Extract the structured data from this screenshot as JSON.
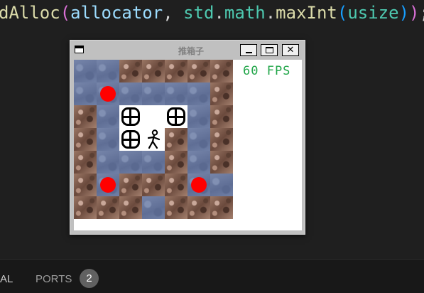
{
  "editor": {
    "tokens": [
      {
        "text": "dAlloc",
        "cls": "tok-fn"
      },
      {
        "text": "(",
        "cls": "tok-p1"
      },
      {
        "text": "allocator",
        "cls": "tok-var"
      },
      {
        "text": ", ",
        "cls": "tok-plain"
      },
      {
        "text": "std",
        "cls": "tok-ns"
      },
      {
        "text": ".",
        "cls": "tok-plain"
      },
      {
        "text": "math",
        "cls": "tok-ns"
      },
      {
        "text": ".",
        "cls": "tok-plain"
      },
      {
        "text": "maxInt",
        "cls": "tok-fn"
      },
      {
        "text": "(",
        "cls": "tok-p2"
      },
      {
        "text": "usize",
        "cls": "tok-ty"
      },
      {
        "text": ")",
        "cls": "tok-p2"
      },
      {
        "text": ")",
        "cls": "tok-p1"
      },
      {
        "text": ";",
        "cls": "tok-plain"
      }
    ]
  },
  "panel": {
    "terminal_tab": "AL",
    "ports_tab": "PORTS",
    "ports_badge": "2"
  },
  "window": {
    "title": "推箱子",
    "close_glyph": "✕",
    "fps_text": "60 FPS"
  },
  "game": {
    "legend": {
      "W": "wall",
      "F": "floor",
      "G": "goal",
      "B": "box",
      "P": "player",
      "E": "empty"
    },
    "grid": [
      "FFWWWWW",
      "FGFFFFW",
      "WFBEBFW",
      "WFBPWFW",
      "WFFFWFW",
      "WGWWWGF",
      "WWWFWWW"
    ]
  }
}
